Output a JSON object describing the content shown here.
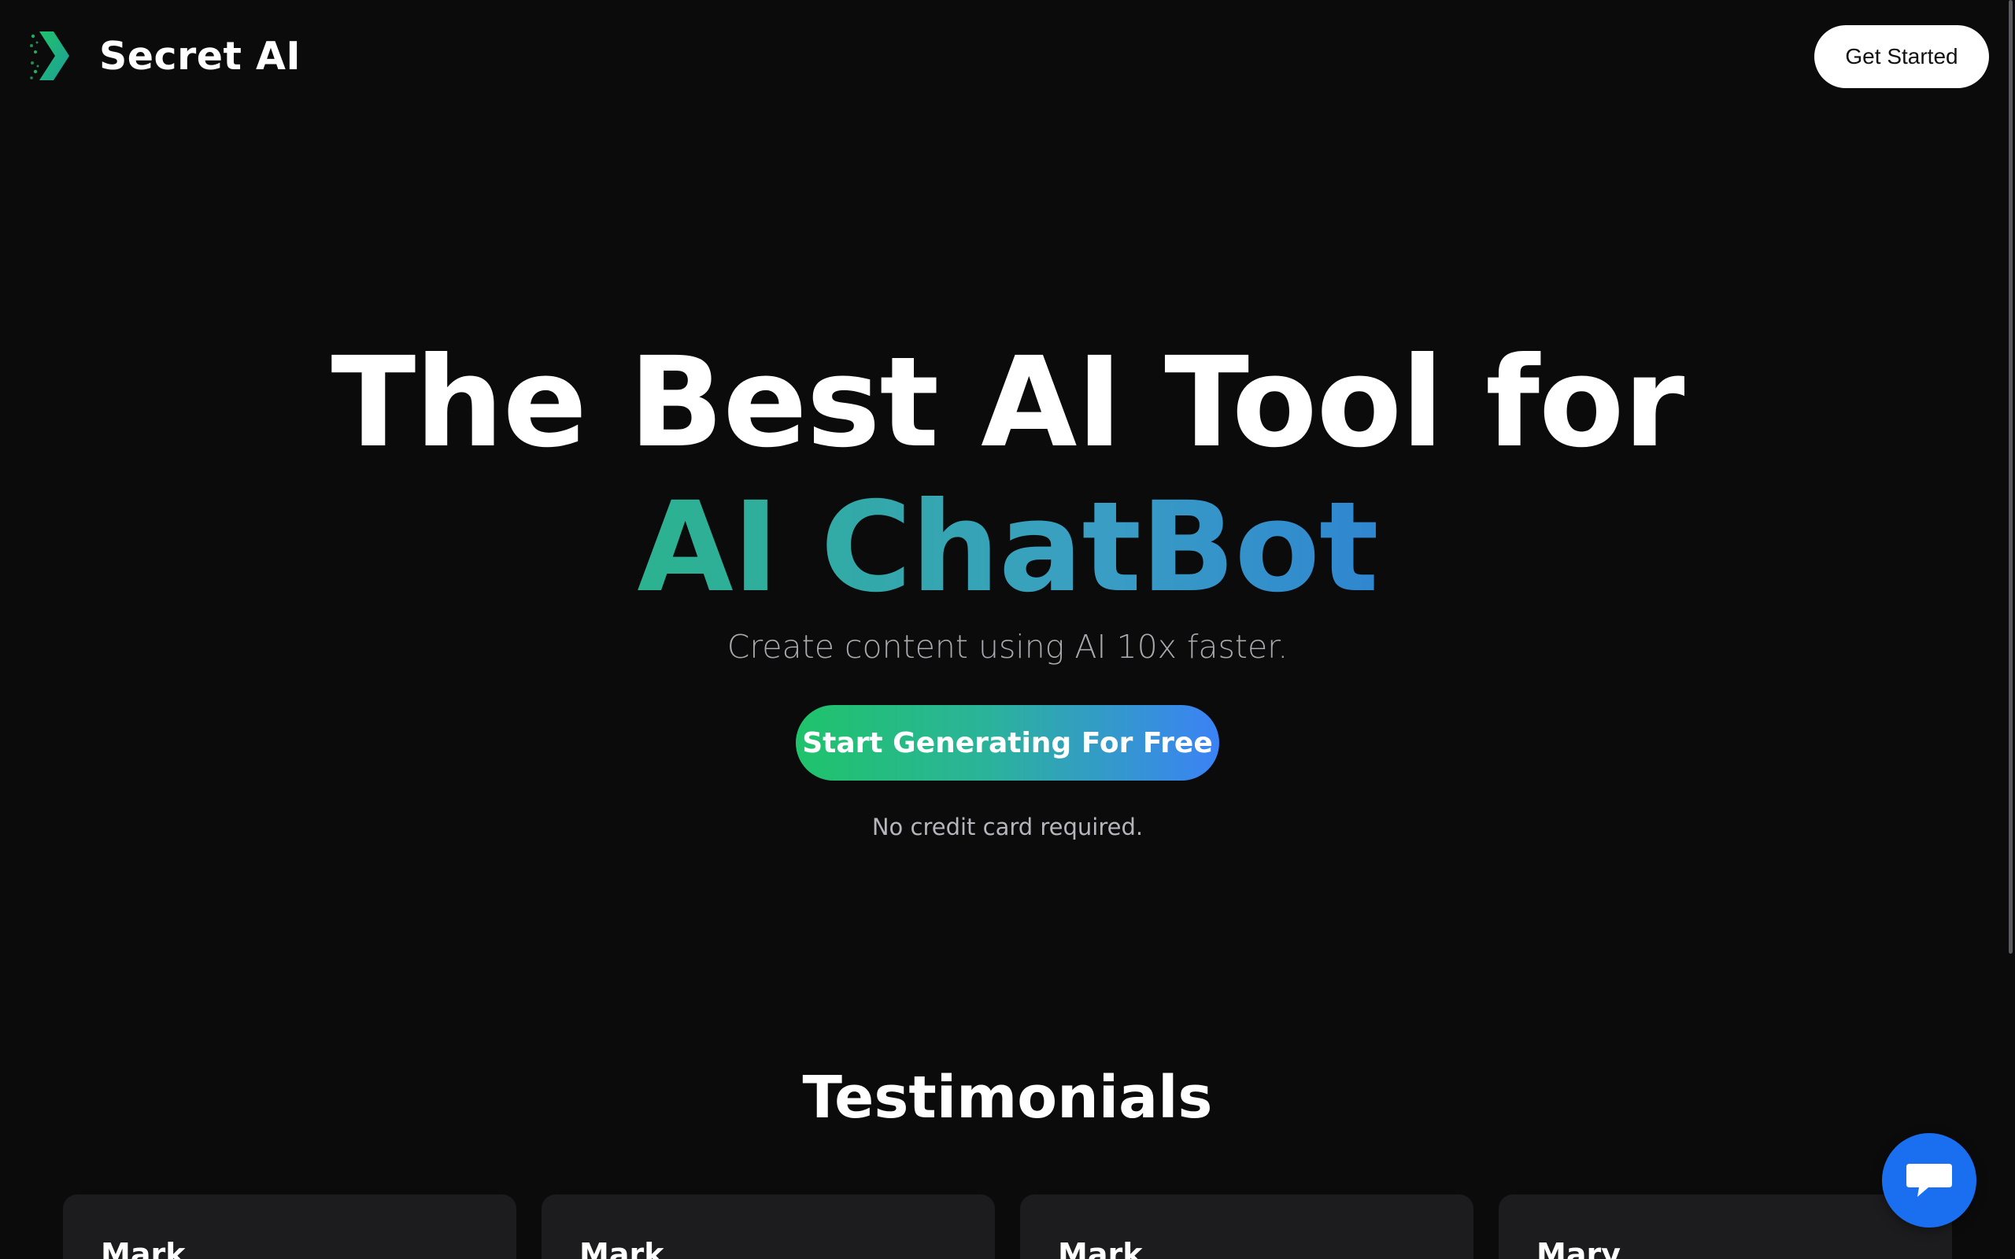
{
  "header": {
    "brand": "Secret AI",
    "cta_label": "Get Started"
  },
  "hero": {
    "title_line1": "The Best AI Tool for",
    "title_line2": "AI ChatBot",
    "subtitle": "Create content using AI 10x faster.",
    "cta_label": "Start Generating For Free",
    "note": "No credit card required."
  },
  "testimonials": {
    "heading": "Testimonials",
    "cards": [
      {
        "name": "Mark"
      },
      {
        "name": "Mark"
      },
      {
        "name": "Mark"
      },
      {
        "name": "Mary"
      }
    ]
  },
  "chat_widget": {
    "icon": "chat-bubble-icon"
  },
  "colors": {
    "background": "#0b0b0c",
    "gradient_text_start": "#2bb38e",
    "gradient_text_end": "#2f86d0",
    "cta_start": "#1fc36b",
    "cta_end": "#3b82f6",
    "chat_button": "#1a6ff0"
  }
}
